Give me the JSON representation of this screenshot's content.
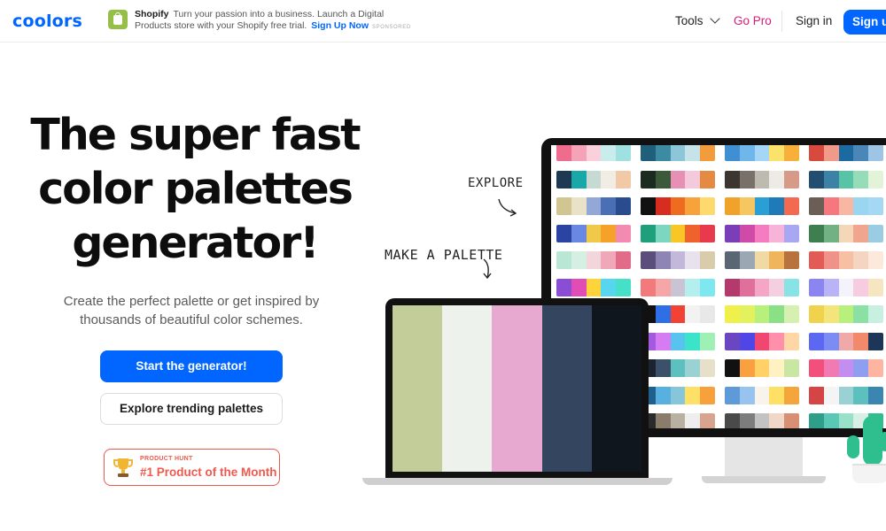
{
  "header": {
    "logo": "coolors",
    "ad": {
      "brand": "Shopify",
      "text": "Turn your passion into a business. Launch a Digital Products store with your Shopify free trial.",
      "cta": "Sign Up Now",
      "sponsored": "SPONSORED"
    },
    "nav": {
      "tools": "Tools",
      "go_pro": "Go Pro",
      "sign_in": "Sign in",
      "sign_up": "Sign up"
    }
  },
  "hero": {
    "title_lines": [
      "The super fast",
      "color palettes",
      "generator!"
    ],
    "subtitle": "Create the perfect palette or get inspired by thousands of beautiful color schemes.",
    "primary_cta": "Start the generator!",
    "secondary_cta": "Explore trending palettes",
    "badge": {
      "label": "PRODUCT HUNT",
      "title": "#1 Product of the Month"
    }
  },
  "illustration": {
    "note_explore": "EXPLORE",
    "note_make": "MAKE A PALETTE",
    "laptop_palette": [
      "#c2cd99",
      "#eef2ec",
      "#e8a9d0",
      "#34455f",
      "#0f161d"
    ],
    "monitor_palettes": [
      [
        [
          "#f06c8f",
          "#f4a3b9",
          "#f9d0dc",
          "#c9ecec",
          "#9fe0e0"
        ],
        [
          "#1f5f7a",
          "#3d8aa3",
          "#8cc6d8",
          "#c7e3ea",
          "#f29c3c"
        ],
        [
          "#3f8fd2",
          "#6fb6ea",
          "#a6d6f5",
          "#fbe36b",
          "#f7b13b"
        ],
        [
          "#d84a3e",
          "#f29a8a",
          "#1c6aa2",
          "#4a87b8",
          "#9ec5e5"
        ]
      ],
      [
        [
          "#1e3a52",
          "#19a8a8",
          "#c7d9d3",
          "#f2ede4",
          "#f1c9a6"
        ],
        [
          "#1c2b1f",
          "#3b5a3a",
          "#e88fb5",
          "#f4c9dc",
          "#e58a42"
        ],
        [
          "#3c3530",
          "#7a706a",
          "#bfbab0",
          "#eeebe6",
          "#d89a88"
        ],
        [
          "#224e6f",
          "#3b82a6",
          "#58c4a6",
          "#97dcb8",
          "#e3f3d8"
        ]
      ],
      [
        [
          "#d1c592",
          "#e9e2c9",
          "#93a8d6",
          "#4b6fb5",
          "#2a4c8f"
        ],
        [
          "#111111",
          "#d62d20",
          "#ef6b1f",
          "#f7a23b",
          "#fdd96e"
        ],
        [
          "#f0a22a",
          "#f6c760",
          "#2a9fd6",
          "#1e7bb8",
          "#f26a4f"
        ],
        [
          "#6b5e57",
          "#f6787e",
          "#f7b7a3",
          "#9bd6f0",
          "#a5d8f3"
        ]
      ],
      [
        [
          "#2b44a4",
          "#6a87e3",
          "#f0c94a",
          "#f6a12a",
          "#f28ab2"
        ],
        [
          "#1fa07c",
          "#7cd6c0",
          "#f8c625",
          "#f0622d",
          "#e83a4c"
        ],
        [
          "#7a3eb8",
          "#d04aa8",
          "#f57cc0",
          "#f8b3d8",
          "#a9a6f2"
        ],
        [
          "#3d7f4e",
          "#72b183",
          "#f4d6b8",
          "#f0a58f",
          "#9acde3"
        ]
      ],
      [
        [
          "#b9e6d5",
          "#d6efe3",
          "#f2d6dc",
          "#f0a8b8",
          "#e36b8a"
        ],
        [
          "#5b4e7a",
          "#8e85b5",
          "#c3b8d9",
          "#e8e2ee",
          "#d9ccaa"
        ],
        [
          "#5a6674",
          "#9aa8b3",
          "#f1d9a4",
          "#f0b55c",
          "#b7723d"
        ],
        [
          "#e25b55",
          "#f0928a",
          "#f7bfa3",
          "#f3d5c2",
          "#fde9dc"
        ]
      ],
      [
        [
          "#8a4dd6",
          "#e14db5",
          "#ffd43b",
          "#57d6f0",
          "#46e0c8"
        ],
        [
          "#f37a7a",
          "#f6a6a6",
          "#c9c3d3",
          "#b2efee",
          "#7ee8f0"
        ],
        [
          "#b43a6e",
          "#e06f9b",
          "#f5a6c6",
          "#f4cfe0",
          "#87e3e6"
        ],
        [
          "#8b85f2",
          "#b8b4f7",
          "#f4f2fb",
          "#f7cbe0",
          "#f5e5c0"
        ]
      ],
      [
        [
          "#f1c232",
          "#f6dc5c",
          "#4caf50",
          "#357a38",
          "#1b5e20"
        ],
        [
          "#111111",
          "#2f6fe6",
          "#f24236",
          "#f2f2f2",
          "#e8e8e8"
        ],
        [
          "#f0f04a",
          "#e3f25c",
          "#b7f07a",
          "#89e085",
          "#d6f0b2"
        ],
        [
          "#f0d24c",
          "#f4e57a",
          "#b7f07a",
          "#8be0a4",
          "#c8f0e0"
        ]
      ],
      [
        [
          "#2438b8",
          "#1e64f0",
          "#fbd43a",
          "#f8a83b",
          "#f07a2a"
        ],
        [
          "#a35adf",
          "#d57cf2",
          "#59c3f0",
          "#3be3c8",
          "#9ef0b4"
        ],
        [
          "#6b46c1",
          "#4f46e5",
          "#ef476f",
          "#ff8fab",
          "#ffd6a5"
        ],
        [
          "#5c67f2",
          "#7c8cf5",
          "#f0a9a9",
          "#f08a6a",
          "#1d3557"
        ]
      ],
      [
        [
          "#b85c4a",
          "#f2a27d",
          "#f8d1b3",
          "#c4b0ea",
          "#a18ef0"
        ],
        [
          "#1b2430",
          "#3a506b",
          "#5bc0be",
          "#9ad1d4",
          "#e8dfc8"
        ],
        [
          "#111111",
          "#f9a03f",
          "#ffd166",
          "#fff1c1",
          "#c9e6a3"
        ],
        [
          "#f24f7c",
          "#f07ab2",
          "#c48ef0",
          "#8e9ef0",
          "#ffb4a2"
        ]
      ],
      [
        [
          "#1e5f8c",
          "#3a86b0",
          "#86c5da",
          "#c6e4ee",
          "#f8a03c"
        ],
        [
          "#1e5f8c",
          "#58b0e0",
          "#86c5da",
          "#ffe066",
          "#f8a03c"
        ],
        [
          "#5e9ad8",
          "#98c3ee",
          "#f8f4ec",
          "#ffe066",
          "#f4a63c"
        ],
        [
          "#d64545",
          "#f4f4f4",
          "#9ad1d4",
          "#5bc0be",
          "#3a86b0"
        ]
      ],
      [
        [
          "#111111",
          "#8b4a2f",
          "#f25c6e",
          "#f7a6b4",
          "#f8d1a8"
        ],
        [
          "#2a2a2a",
          "#8b7b6a",
          "#b8b0a0",
          "#eeeeee",
          "#d8a48f"
        ],
        [
          "#4a4a4a",
          "#7d7d7d",
          "#c2c2c2",
          "#f0d8c8",
          "#d88f73"
        ],
        [
          "#2f9f8a",
          "#5ac8b4",
          "#98e0c8",
          "#d8f0e4",
          "#2fbf8f"
        ]
      ]
    ]
  }
}
